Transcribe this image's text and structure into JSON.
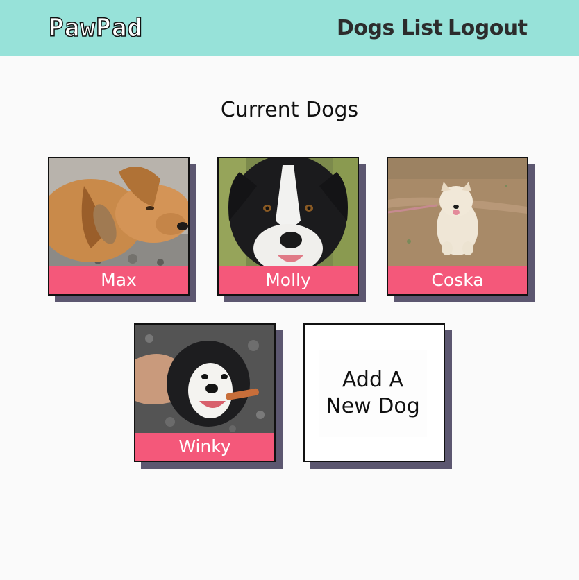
{
  "header": {
    "logo": "PawPad",
    "nav": {
      "dogs_list": "Dogs List",
      "logout": "Logout"
    }
  },
  "main": {
    "title": "Current Dogs",
    "dogs": [
      {
        "name": "Max"
      },
      {
        "name": "Molly"
      },
      {
        "name": "Coska"
      },
      {
        "name": "Winky"
      }
    ],
    "add_card": {
      "line1": "Add A",
      "line2": "New Dog"
    }
  },
  "colors": {
    "navbar": "#97e2d9",
    "name_bar": "#f4587a",
    "card_shadow": "#5c5770",
    "background": "#fafafa"
  }
}
